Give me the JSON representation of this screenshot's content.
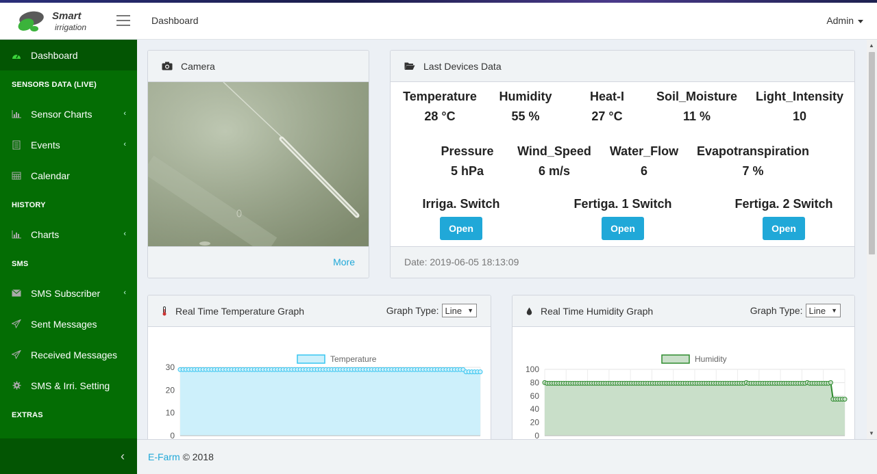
{
  "header": {
    "logo_line1": "Smart",
    "logo_line2": "irrigation",
    "breadcrumb": "Dashboard",
    "user": "Admin"
  },
  "sidebar": {
    "items": [
      {
        "label": "Dashboard",
        "icon": "tachometer-icon",
        "active": true
      },
      {
        "section": "SENSORS DATA (LIVE)"
      },
      {
        "label": "Sensor Charts",
        "icon": "bar-chart-icon",
        "chevron": true
      },
      {
        "label": "Events",
        "icon": "document-icon",
        "chevron": true
      },
      {
        "label": "Calendar",
        "icon": "calendar-icon"
      },
      {
        "section": "HISTORY"
      },
      {
        "label": "Charts",
        "icon": "bar-chart-icon",
        "chevron": true
      },
      {
        "section": "SMS"
      },
      {
        "label": "SMS Subscriber",
        "icon": "envelope-icon",
        "chevron": true
      },
      {
        "label": "Sent Messages",
        "icon": "paper-plane-icon"
      },
      {
        "label": "Received Messages",
        "icon": "paper-plane-icon"
      },
      {
        "label": "SMS & Irri. Setting",
        "icon": "gear-icon"
      },
      {
        "section": "EXTRAS"
      }
    ]
  },
  "camera": {
    "title": "Camera",
    "more": "More"
  },
  "devices": {
    "title": "Last Devices Data",
    "row1": [
      {
        "label": "Temperature",
        "value": "28 °C"
      },
      {
        "label": "Humidity",
        "value": "55 %"
      },
      {
        "label": "Heat-I",
        "value": "27 °C"
      },
      {
        "label": "Soil_Moisture",
        "value": "11 %"
      },
      {
        "label": "Light_Intensity",
        "value": "10"
      }
    ],
    "row2": [
      {
        "label": "Pressure",
        "value": "5 hPa"
      },
      {
        "label": "Wind_Speed",
        "value": "6 m/s"
      },
      {
        "label": "Water_Flow",
        "value": "6"
      },
      {
        "label": "Evapotranspiration",
        "value": "7 %"
      }
    ],
    "switches": [
      {
        "label": "Irriga. Switch",
        "button": "Open"
      },
      {
        "label": "Fertiga. 1 Switch",
        "button": "Open"
      },
      {
        "label": "Fertiga. 2 Switch",
        "button": "Open"
      }
    ],
    "date": "Date: 2019-06-05 18:13:09"
  },
  "temp_graph": {
    "title": "Real Time Temperature Graph",
    "graph_type_label": "Graph Type:",
    "graph_type_value": "Line"
  },
  "hum_graph": {
    "title": "Real Time Humidity Graph",
    "graph_type_label": "Graph Type:",
    "graph_type_value": "Line"
  },
  "chart_data": [
    {
      "type": "area",
      "legend": [
        "Temperature"
      ],
      "color": "#36c5f0",
      "fill": "#cdf0fb",
      "yticks": [
        30,
        20,
        10,
        0
      ],
      "ylim": [
        0,
        30
      ],
      "series": [
        {
          "name": "Temperature",
          "values": [
            29,
            29,
            29,
            29,
            29,
            29,
            29,
            29,
            29,
            29,
            29,
            29,
            29,
            29,
            29,
            29,
            29,
            29,
            29,
            29,
            29,
            29,
            29,
            29,
            29,
            29,
            29,
            29,
            29,
            29,
            29,
            29,
            29,
            29,
            29,
            29,
            29,
            29,
            29,
            29,
            29,
            29,
            29,
            29,
            29,
            29,
            29,
            29,
            29,
            29,
            29,
            29,
            29,
            29,
            29,
            29,
            29,
            29,
            29,
            29,
            29,
            29,
            29,
            29,
            29,
            29,
            29,
            29,
            29,
            29,
            29,
            29,
            29,
            29,
            29,
            29,
            29,
            29,
            29,
            29,
            29,
            29,
            29,
            29,
            29,
            29,
            29,
            29,
            29,
            29,
            29,
            29,
            29,
            29,
            29,
            29,
            29,
            29,
            29,
            29,
            28,
            28,
            28,
            28,
            28,
            28
          ]
        }
      ]
    },
    {
      "type": "area",
      "legend": [
        "Humidity"
      ],
      "color": "#2e8b2e",
      "fill": "#c9dfc9",
      "yticks": [
        100,
        80,
        60,
        40,
        20,
        0
      ],
      "ylim": [
        0,
        100
      ],
      "series": [
        {
          "name": "Humidity",
          "values": [
            80,
            79,
            79,
            79,
            79,
            79,
            79,
            79,
            79,
            79,
            79,
            79,
            79,
            79,
            79,
            79,
            79,
            79,
            79,
            79,
            79,
            79,
            79,
            79,
            79,
            79,
            79,
            79,
            79,
            79,
            79,
            79,
            79,
            79,
            79,
            79,
            79,
            79,
            79,
            79,
            79,
            79,
            79,
            79,
            79,
            79,
            79,
            79,
            79,
            79,
            79,
            79,
            79,
            79,
            79,
            79,
            79,
            79,
            79,
            79,
            79,
            79,
            79,
            79,
            79,
            79,
            79,
            79,
            79,
            79,
            79,
            79,
            79,
            79,
            79,
            79,
            79,
            79,
            79,
            79,
            79,
            79,
            79,
            79,
            79,
            79,
            80,
            79,
            79,
            79,
            79,
            79,
            79,
            79,
            79,
            79,
            79,
            79,
            79,
            79,
            79,
            79,
            79,
            79,
            79,
            79,
            79,
            79,
            79,
            79,
            79,
            79,
            80,
            79,
            79,
            79,
            79,
            79,
            79,
            79,
            79,
            79,
            80,
            55,
            55,
            55,
            55,
            55,
            55
          ]
        }
      ]
    }
  ],
  "footer": {
    "brand": "E-Farm",
    "copy": "© 2018"
  }
}
